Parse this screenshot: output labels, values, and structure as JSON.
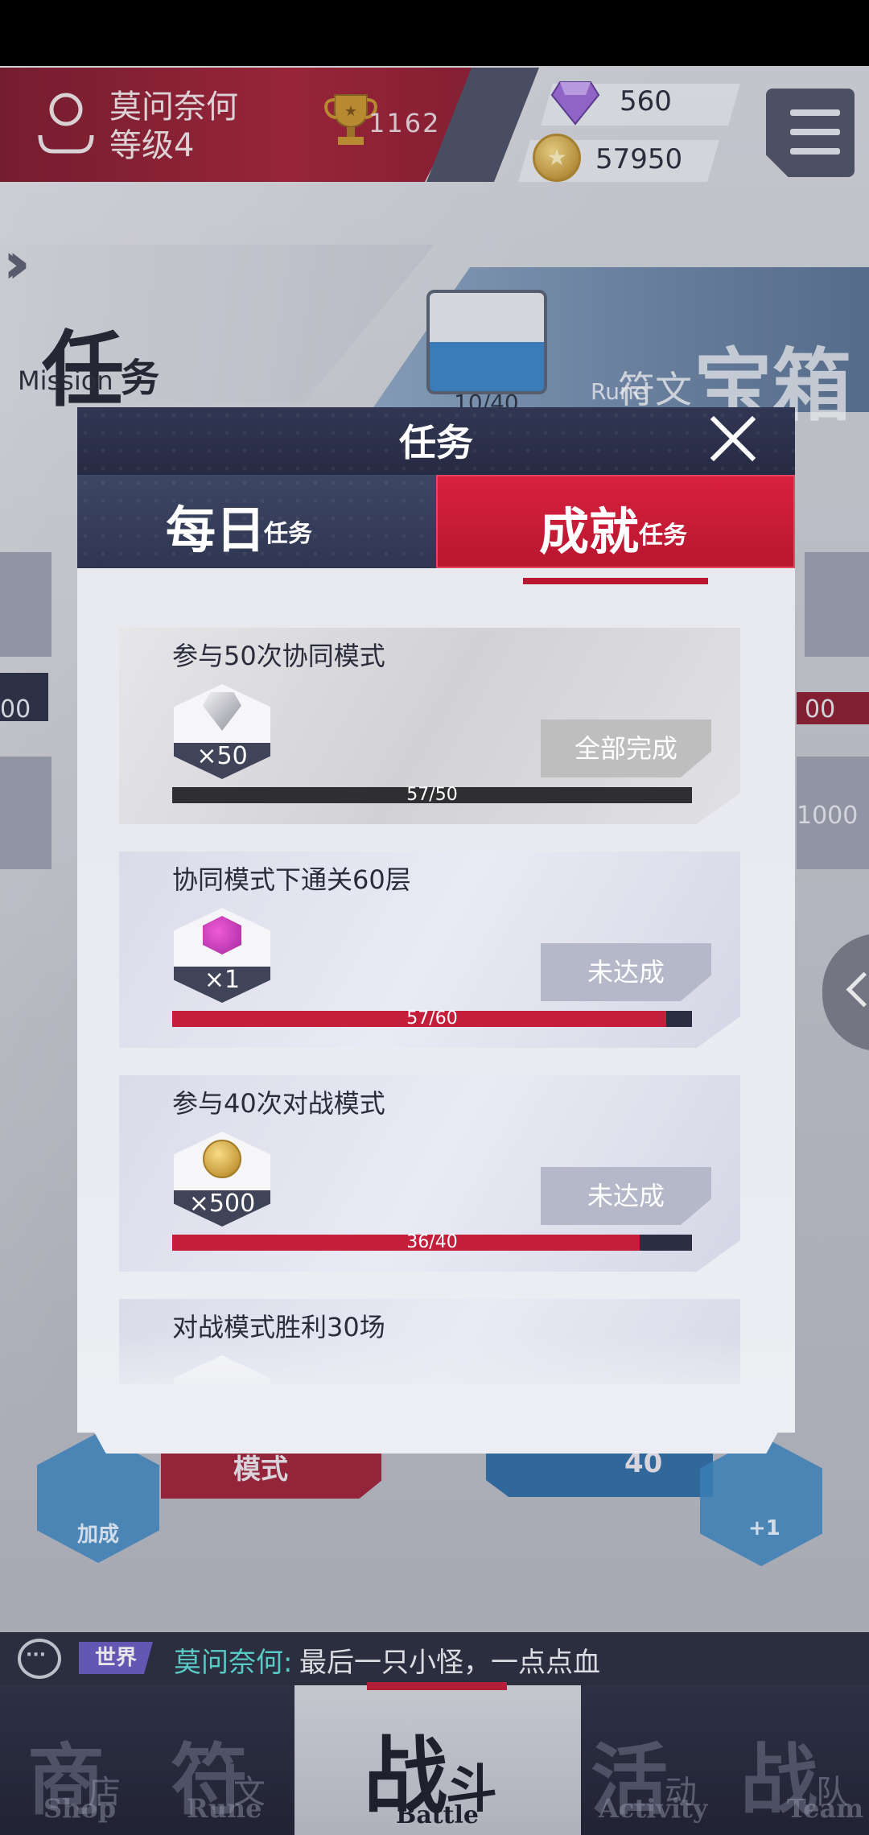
{
  "player": {
    "name": "莫问奈何",
    "level": "等级4",
    "trophies": "1162"
  },
  "currency": {
    "gems": "560",
    "coins": "57950"
  },
  "mission_banner": {
    "title_big": "任",
    "title_small": "务",
    "english": "Mission"
  },
  "chest_banner": {
    "count": "10/40",
    "title": "宝箱",
    "subtitle": "符文",
    "english": "Rune"
  },
  "side": {
    "left_number": "00",
    "right_number": "00",
    "right_price": "1000"
  },
  "background_buttons": {
    "left_hex_label": "加成",
    "red_button_label": "模式",
    "blue_button_value": "40",
    "right_hex_label": "+1"
  },
  "modal": {
    "title": "任务",
    "tabs": [
      {
        "big": "每日",
        "small": "任务",
        "active": false
      },
      {
        "big": "成就",
        "small": "任务",
        "active": true
      }
    ]
  },
  "tasks": [
    {
      "title": "参与50次协同模式",
      "reward_icon": "diamond-icon",
      "reward_qty": "×50",
      "status": "全部完成",
      "progress": "57/50",
      "progress_ratio": 1.0,
      "state": "done"
    },
    {
      "title": "协同模式下通关60层",
      "reward_icon": "token-icon",
      "reward_qty": "×1",
      "status": "未达成",
      "progress": "57/60",
      "progress_ratio": 0.95,
      "state": "pending"
    },
    {
      "title": "参与40次对战模式",
      "reward_icon": "coin-icon",
      "reward_qty": "×500",
      "status": "未达成",
      "progress": "36/40",
      "progress_ratio": 0.9,
      "state": "pending"
    },
    {
      "title": "对战模式胜利30场",
      "reward_icon": "diamond-icon",
      "reward_qty": "",
      "status": "",
      "progress": "",
      "progress_ratio": 0,
      "state": "pending"
    }
  ],
  "chat": {
    "channel": "世界",
    "sender": "莫问奈何:",
    "message": "最后一只小怪，一点点血"
  },
  "nav": [
    {
      "big": "商",
      "small": "店",
      "en": "Shop",
      "active": false
    },
    {
      "big": "符",
      "small": "文",
      "en": "Rune",
      "active": false
    },
    {
      "big": "战",
      "small": "斗",
      "en": "Battle",
      "active": true
    },
    {
      "big": "活",
      "small": "动",
      "en": "Activity",
      "active": false
    },
    {
      "big": "战",
      "small": "队",
      "en": "Team",
      "active": false
    }
  ],
  "colors": {
    "accent_red": "#c41e3a",
    "header_navy": "#2b3049",
    "chat_name": "#5ee0d8"
  }
}
